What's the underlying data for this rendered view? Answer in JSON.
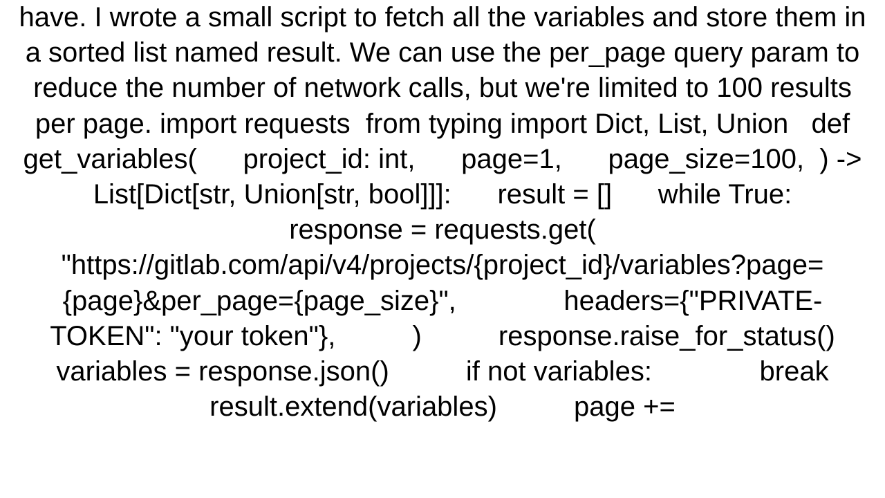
{
  "content": "have. I wrote a small script to fetch all the variables and store them in a sorted list named result. We can use the per_page query param to reduce the number of network calls, but we're limited to 100 results per page. import requests  from typing import Dict, List, Union   def get_variables(      project_id: int,      page=1,      page_size=100,  ) -> List[Dict[str, Union[str, bool]]]:      result = []      while True:          response = requests.get(              \"https://gitlab.com/api/v4/projects/{project_id}/variables?page={page}&per_page={page_size}\",              headers={\"PRIVATE-TOKEN\": \"your token\"},          )          response.raise_for_status()            variables = response.json()          if not variables:              break            result.extend(variables)          page +="
}
